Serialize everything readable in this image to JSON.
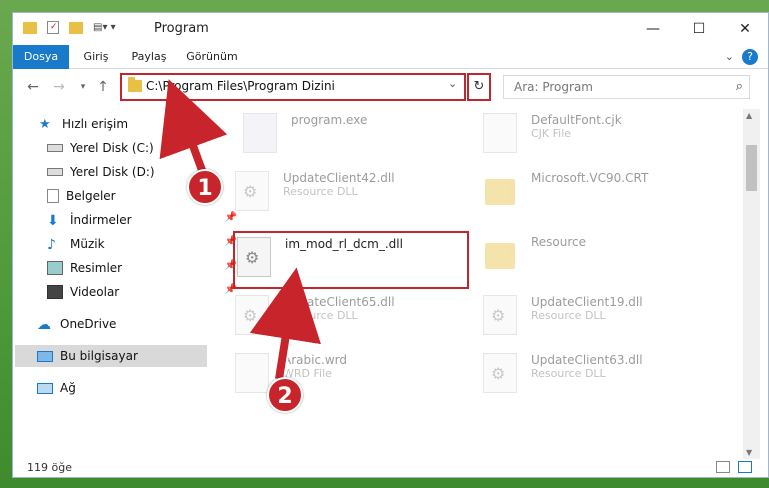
{
  "window": {
    "title": "Program",
    "controls": {
      "minimize": "—",
      "maximize": "☐",
      "close": "✕"
    }
  },
  "ribbon": {
    "tabs": [
      "Dosya",
      "Giriş",
      "Paylaş",
      "Görünüm"
    ],
    "active_tab": "Dosya",
    "help": "?"
  },
  "address": {
    "path": "C:\\Program Files\\Program Dizini",
    "search_placeholder": "Ara: Program"
  },
  "sidebar": {
    "items": [
      {
        "label": "Hızlı erişim",
        "icon": "star-icon"
      },
      {
        "label": "Yerel Disk (C:)",
        "icon": "drive-icon"
      },
      {
        "label": "Yerel Disk (D:)",
        "icon": "drive-icon"
      },
      {
        "label": "Belgeler",
        "icon": "documents-icon"
      },
      {
        "label": "İndirmeler",
        "icon": "download-icon"
      },
      {
        "label": "Müzik",
        "icon": "music-icon"
      },
      {
        "label": "Resimler",
        "icon": "pictures-icon"
      },
      {
        "label": "Videolar",
        "icon": "video-icon"
      },
      {
        "label": "OneDrive",
        "icon": "cloud-icon"
      },
      {
        "label": "Bu bilgisayar",
        "icon": "computer-icon"
      },
      {
        "label": "Ağ",
        "icon": "network-icon"
      }
    ]
  },
  "files": [
    {
      "name": "program.exe",
      "type": ""
    },
    {
      "name": "DefaultFont.cjk",
      "type": "CJK File"
    },
    {
      "name": "UpdateClient42.dll",
      "type": "Resource DLL"
    },
    {
      "name": "Microsoft.VC90.CRT",
      "type": ""
    },
    {
      "name": "im_mod_rl_dcm_.dll",
      "type": ""
    },
    {
      "name": "Resource",
      "type": ""
    },
    {
      "name": "UpdateClient65.dll",
      "type": "Resource DLL"
    },
    {
      "name": "UpdateClient19.dll",
      "type": "Resource DLL"
    },
    {
      "name": "Arabic.wrd",
      "type": "WRD File"
    },
    {
      "name": "UpdateClient63.dll",
      "type": "Resource DLL"
    }
  ],
  "status": {
    "count": "119 öğe"
  },
  "callouts": [
    "1",
    "2"
  ],
  "colors": {
    "accent": "#1979ca",
    "highlight": "#c0262d"
  }
}
